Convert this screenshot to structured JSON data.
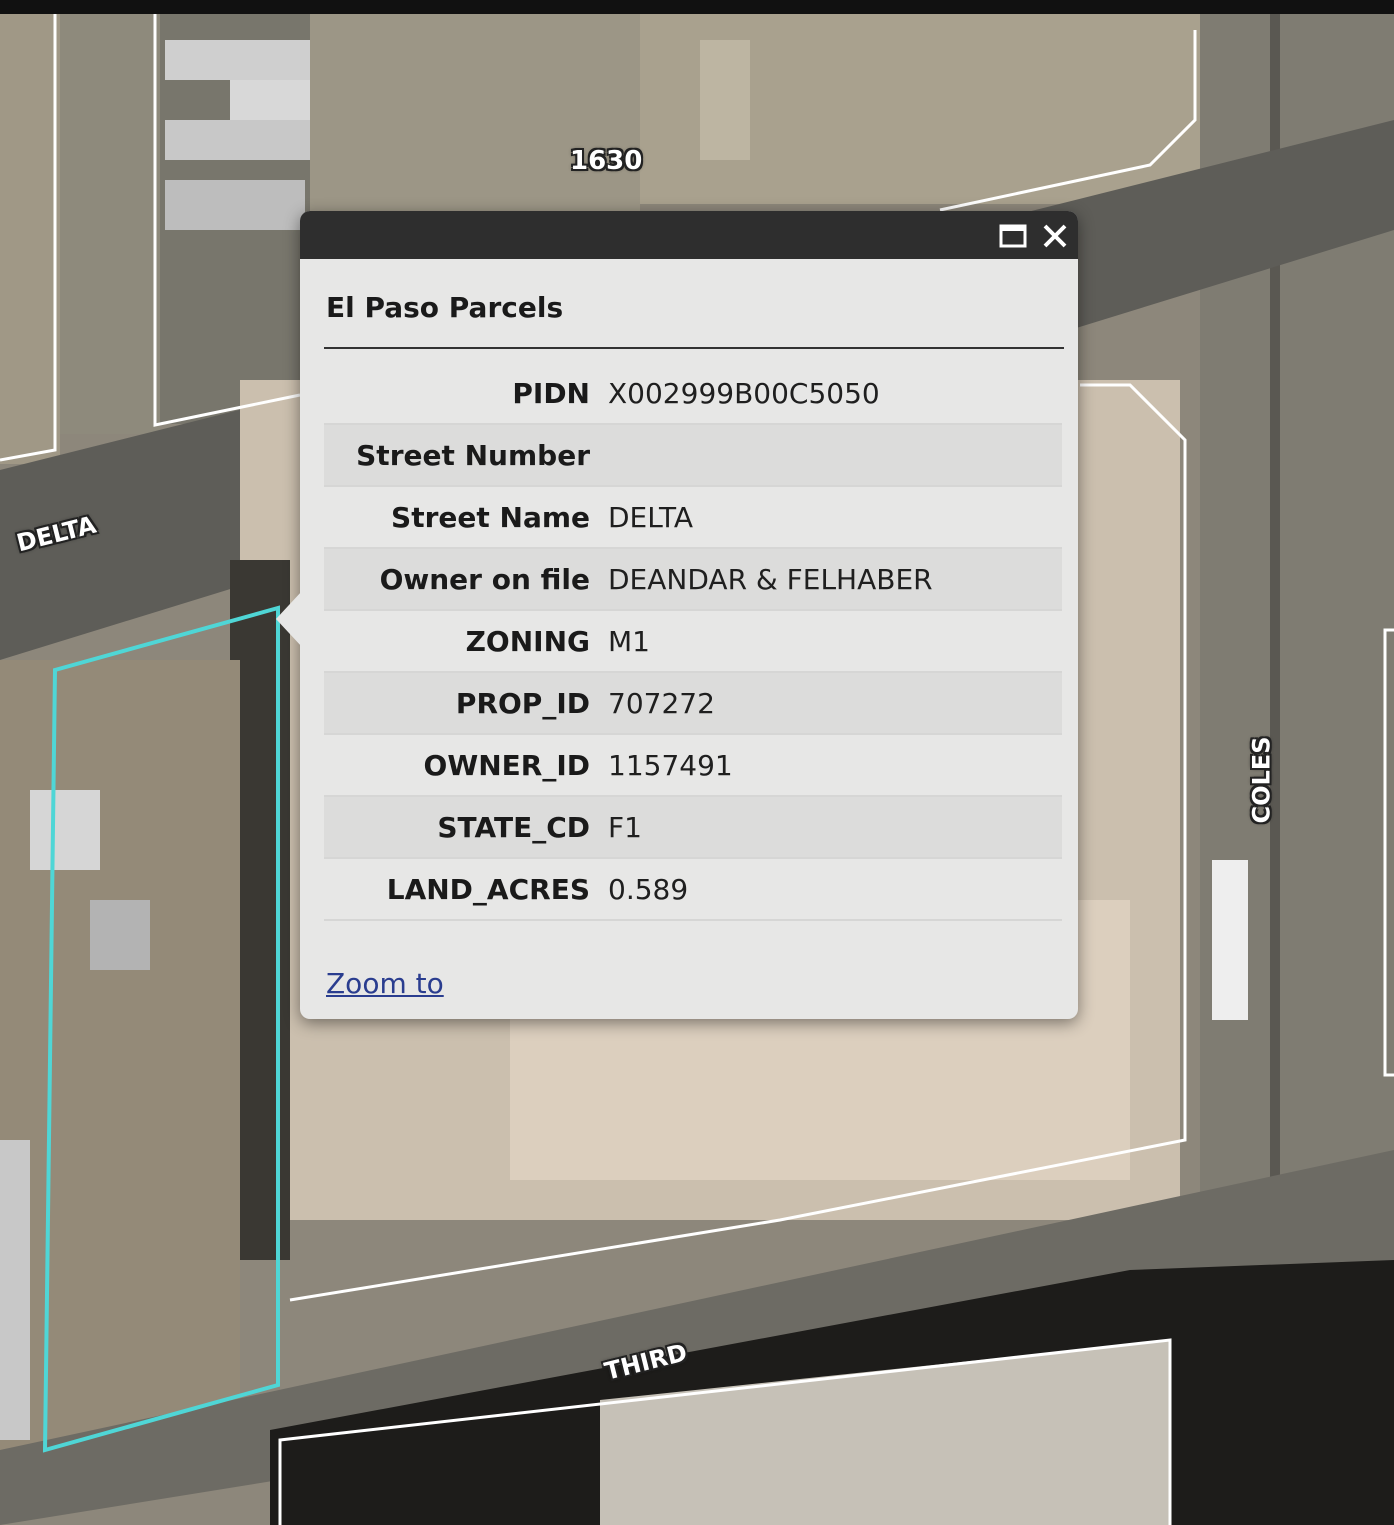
{
  "map": {
    "street_labels": {
      "highway": "1630",
      "delta": "DELTA",
      "coles": "COLES",
      "third": "THIRD"
    },
    "selection_color": "#4fd6d6"
  },
  "popup": {
    "title": "El Paso Parcels",
    "maximize_icon": "maximize-icon",
    "close_icon": "close-icon",
    "attributes": [
      {
        "key": "PIDN",
        "value": "X002999B00C5050"
      },
      {
        "key": "Street Number",
        "value": ""
      },
      {
        "key": "Street Name",
        "value": "DELTA"
      },
      {
        "key": "Owner on file",
        "value": "DEANDAR & FELHABER"
      },
      {
        "key": "ZONING",
        "value": "M1"
      },
      {
        "key": "PROP_ID",
        "value": "707272"
      },
      {
        "key": "OWNER_ID",
        "value": "1157491"
      },
      {
        "key": "STATE_CD",
        "value": "F1"
      },
      {
        "key": "LAND_ACRES",
        "value": "0.589"
      }
    ],
    "zoom_link": "Zoom to"
  }
}
